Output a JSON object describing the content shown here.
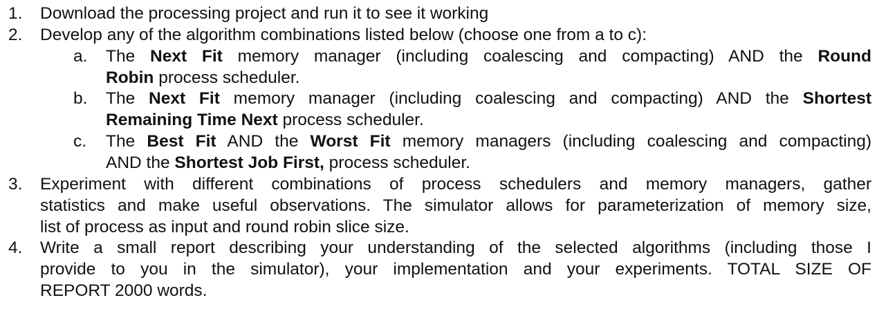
{
  "items": [
    {
      "number": "1.",
      "lines": [
        "Download the processing project and run it to see it working"
      ]
    },
    {
      "number": "2.",
      "lines": [
        "Develop any of the algorithm combinations listed below (choose one from a to c):"
      ],
      "subitems": [
        {
          "letter": "a.",
          "l1_a": "The ",
          "l1_b": "Next Fit",
          "l1_c": " memory manager (including coalescing and compacting) AND the ",
          "l1_d": "Round",
          "l2_a": "Robin",
          "l2_b": " process scheduler."
        },
        {
          "letter": "b.",
          "l1_a": "The ",
          "l1_b": "Next Fit",
          "l1_c": " memory manager (including coalescing and compacting) AND the ",
          "l1_d": "Shortest",
          "l2_a": "Remaining Time Next",
          "l2_b": " process scheduler."
        },
        {
          "letter": "c.",
          "l1_a": "The ",
          "l1_b": "Best Fit",
          "l1_c": " AND the ",
          "l1_d": "Worst Fit",
          "l1_e": " memory managers (including coalescing and compacting)",
          "l2_a": "AND the ",
          "l2_b": "Shortest Job First,",
          "l2_c": " process scheduler."
        }
      ]
    },
    {
      "number": "3.",
      "lines": [
        "Experiment with different combinations of process schedulers and memory managers, gather",
        "statistics and make useful observations. The simulator allows for parameterization of memory size,",
        "list of process as input and round robin slice size."
      ]
    },
    {
      "number": "4.",
      "lines": [
        "Write a small report describing your understanding of the selected algorithms (including those I",
        "provide to you in the simulator), your implementation and your experiments. TOTAL SIZE OF",
        "REPORT 2000 words."
      ]
    }
  ]
}
